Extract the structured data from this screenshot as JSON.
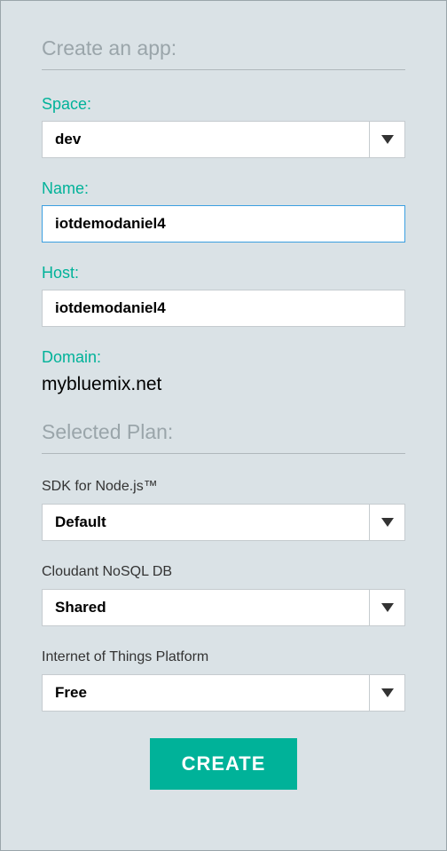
{
  "header": {
    "title": "Create an app:"
  },
  "form": {
    "space": {
      "label": "Space:",
      "value": "dev"
    },
    "name": {
      "label": "Name:",
      "value": "iotdemodaniel4"
    },
    "host": {
      "label": "Host:",
      "value": "iotdemodaniel4"
    },
    "domain": {
      "label": "Domain:",
      "value": "mybluemix.net"
    }
  },
  "plans": {
    "title": "Selected Plan:",
    "items": [
      {
        "label": "SDK for Node.js™",
        "value": "Default"
      },
      {
        "label": "Cloudant NoSQL DB",
        "value": "Shared"
      },
      {
        "label": "Internet of Things Platform",
        "value": "Free"
      }
    ]
  },
  "actions": {
    "create": "CREATE"
  }
}
